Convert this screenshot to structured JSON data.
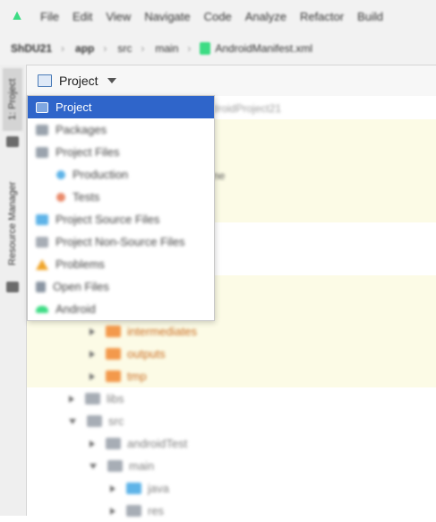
{
  "menubar": {
    "items": [
      "File",
      "Edit",
      "View",
      "Navigate",
      "Code",
      "Analyze",
      "Refactor",
      "Build"
    ]
  },
  "navbar": {
    "crumbs": [
      "ShDU21",
      "app",
      "src",
      "main"
    ],
    "file": "AndroidManifest.xml"
  },
  "side_tabs": {
    "project": "1: Project",
    "resource_manager": "Resource Manager"
  },
  "panel": {
    "title": "Project",
    "path_hint": "ndroidProject21"
  },
  "dropdown": {
    "items": [
      {
        "label": "Project",
        "icon": "project-icon",
        "selected": true
      },
      {
        "label": "Packages",
        "icon": "packages-icon"
      },
      {
        "label": "Project Files",
        "icon": "project-files-icon"
      },
      {
        "label": "Production",
        "icon": "production-icon"
      },
      {
        "label": "Tests",
        "icon": "tests-icon"
      },
      {
        "label": "Project Source Files",
        "icon": "source-files-icon"
      },
      {
        "label": "Project Non-Source Files",
        "icon": "non-source-files-icon"
      },
      {
        "label": "Problems",
        "icon": "warning-icon"
      },
      {
        "label": "Open Files",
        "icon": "open-files-icon"
      },
      {
        "label": "Android",
        "icon": "android-icon"
      }
    ]
  },
  "tree": {
    "partial_label": "ne",
    "rows": [
      {
        "label": "intermediates",
        "folder": "orange"
      },
      {
        "label": "outputs",
        "folder": "orange"
      },
      {
        "label": "tmp",
        "folder": "orange"
      },
      {
        "label": "libs",
        "folder": "grey"
      },
      {
        "label": "src",
        "folder": "grey"
      },
      {
        "label": "androidTest",
        "folder": "grey"
      },
      {
        "label": "main",
        "folder": "grey"
      },
      {
        "label": "java",
        "folder": "blue"
      },
      {
        "label": "res",
        "folder": "grey"
      }
    ]
  },
  "colors": {
    "selection": "#2f65ca",
    "highlight_bg": "#fcfbe6",
    "build_folder": "#f3994c",
    "android_green": "#3ddc84"
  }
}
